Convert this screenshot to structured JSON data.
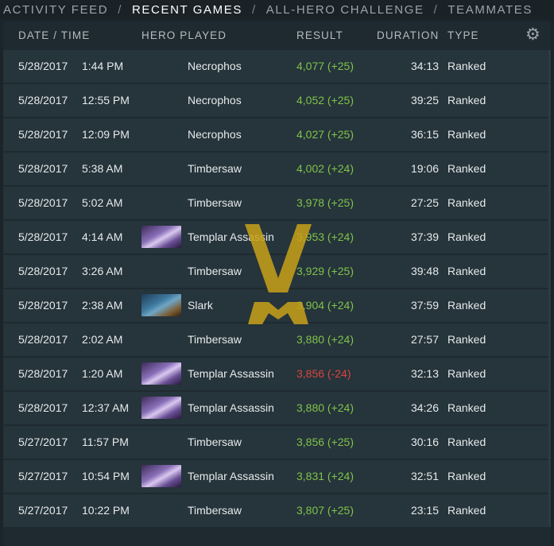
{
  "nav": {
    "tabs": [
      "ACTIVITY FEED",
      "RECENT GAMES",
      "ALL-HERO CHALLENGE",
      "TEAMMATES"
    ],
    "active": "RECENT GAMES"
  },
  "table": {
    "headers": {
      "date_time": "DATE / TIME",
      "hero": "HERO PLAYED",
      "result": "RESULT",
      "duration": "DURATION",
      "type": "TYPE"
    },
    "settings_icon": "gear-icon",
    "rows": [
      {
        "date": "5/28/2017",
        "time": "1:44 PM",
        "hero": "Necrophos",
        "portrait": "necrophos",
        "result": "4,077 (+25)",
        "outcome": "win",
        "duration": "34:13",
        "type": "Ranked"
      },
      {
        "date": "5/28/2017",
        "time": "12:55 PM",
        "hero": "Necrophos",
        "portrait": "necrophos",
        "result": "4,052 (+25)",
        "outcome": "win",
        "duration": "39:25",
        "type": "Ranked"
      },
      {
        "date": "5/28/2017",
        "time": "12:09 PM",
        "hero": "Necrophos",
        "portrait": "necrophos",
        "result": "4,027 (+25)",
        "outcome": "win",
        "duration": "36:15",
        "type": "Ranked"
      },
      {
        "date": "5/28/2017",
        "time": "5:38 AM",
        "hero": "Timbersaw",
        "portrait": "timbersaw",
        "result": "4,002 (+24)",
        "outcome": "win",
        "duration": "19:06",
        "type": "Ranked"
      },
      {
        "date": "5/28/2017",
        "time": "5:02 AM",
        "hero": "Timbersaw",
        "portrait": "timbersaw",
        "result": "3,978 (+25)",
        "outcome": "win",
        "duration": "27:25",
        "type": "Ranked"
      },
      {
        "date": "5/28/2017",
        "time": "4:14 AM",
        "hero": "Templar Assassin",
        "portrait": "templar",
        "result": "3,953 (+24)",
        "outcome": "win",
        "duration": "37:39",
        "type": "Ranked"
      },
      {
        "date": "5/28/2017",
        "time": "3:26 AM",
        "hero": "Timbersaw",
        "portrait": "timbersaw",
        "result": "3,929 (+25)",
        "outcome": "win",
        "duration": "39:48",
        "type": "Ranked"
      },
      {
        "date": "5/28/2017",
        "time": "2:38 AM",
        "hero": "Slark",
        "portrait": "slark",
        "result": "3,904 (+24)",
        "outcome": "win",
        "duration": "37:59",
        "type": "Ranked"
      },
      {
        "date": "5/28/2017",
        "time": "2:02 AM",
        "hero": "Timbersaw",
        "portrait": "timbersaw",
        "result": "3,880 (+24)",
        "outcome": "win",
        "duration": "27:57",
        "type": "Ranked"
      },
      {
        "date": "5/28/2017",
        "time": "1:20 AM",
        "hero": "Templar Assassin",
        "portrait": "templar",
        "result": "3,856 (-24)",
        "outcome": "loss",
        "duration": "32:13",
        "type": "Ranked"
      },
      {
        "date": "5/28/2017",
        "time": "12:37 AM",
        "hero": "Templar Assassin",
        "portrait": "templar",
        "result": "3,880 (+24)",
        "outcome": "win",
        "duration": "34:26",
        "type": "Ranked"
      },
      {
        "date": "5/27/2017",
        "time": "11:57 PM",
        "hero": "Timbersaw",
        "portrait": "timbersaw",
        "result": "3,856 (+25)",
        "outcome": "win",
        "duration": "30:16",
        "type": "Ranked"
      },
      {
        "date": "5/27/2017",
        "time": "10:54 PM",
        "hero": "Templar Assassin",
        "portrait": "templar",
        "result": "3,831 (+24)",
        "outcome": "win",
        "duration": "32:51",
        "type": "Ranked"
      },
      {
        "date": "5/27/2017",
        "time": "10:22 PM",
        "hero": "Timbersaw",
        "portrait": "timbersaw",
        "result": "3,807 (+25)",
        "outcome": "win",
        "duration": "23:15",
        "type": "Ranked"
      }
    ]
  },
  "colors": {
    "win": "#7fc34a",
    "loss": "#d9453f",
    "watermark": "#c9a21a"
  }
}
